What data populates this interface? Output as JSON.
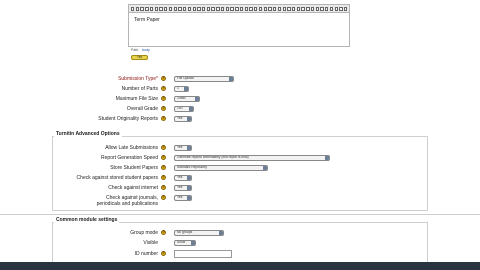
{
  "editor": {
    "toolbar_buttons": 46,
    "content": "Term Paper",
    "path_items": [
      "Path:",
      "body"
    ],
    "chip_label": "Yes"
  },
  "fields": [
    {
      "label": "Submission Type*",
      "required": true,
      "value": "File Upload"
    },
    {
      "label": "Number of Parts",
      "required": false,
      "value": "1"
    },
    {
      "label": "Maximum File Size",
      "required": false,
      "value": "20MB"
    },
    {
      "label": "Overall Grade",
      "required": false,
      "value": "100"
    },
    {
      "label": "Student Originality Reports",
      "required": false,
      "value": "Yes"
    }
  ],
  "turnitin_section": {
    "title": "Turnitin Advanced Options",
    "fields": [
      {
        "label": "Allow Late Submissions",
        "value": "Yes"
      },
      {
        "label": "Report Generation Speed",
        "value": "Generate reports immediately (first report is final)"
      },
      {
        "label": "Store Student Papers",
        "value": "Standard Repository"
      },
      {
        "label": "Check against stored student papers",
        "value": "Yes"
      },
      {
        "label": "Check against internet",
        "value": "Yes"
      },
      {
        "label": "Check against journals,",
        "label2": "periodicals and publications",
        "value": "Yes"
      }
    ]
  },
  "common_section": {
    "title": "Common module settings",
    "fields": [
      {
        "label": "Group mode",
        "value": "No groups"
      },
      {
        "label": "Visible",
        "value": "Show"
      },
      {
        "label": "ID number",
        "value": ""
      }
    ]
  },
  "colors": {
    "required_label": "#8b1414",
    "help_icon": "#d9a516",
    "bottom_bar": "#2a3440"
  }
}
